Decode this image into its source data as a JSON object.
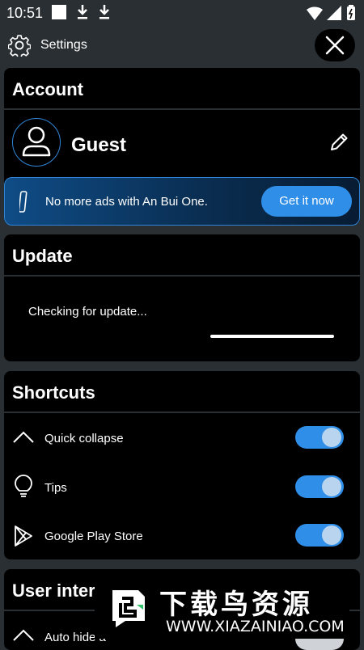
{
  "status_bar": {
    "time": "10:51"
  },
  "header": {
    "title": "Settings",
    "icons": {
      "settings": "gear-icon",
      "close": "close-icon"
    }
  },
  "account": {
    "title": "Account",
    "user_name": "Guest",
    "icons": {
      "avatar": "user-avatar-icon",
      "edit": "pencil-icon"
    }
  },
  "promo": {
    "text": "No more ads with An Bui One.",
    "button_label": "Get it now",
    "colors": {
      "accent": "#2f8ee8",
      "border": "#2f86d6"
    }
  },
  "update": {
    "title": "Update",
    "status": "Checking for update..."
  },
  "shortcuts": {
    "title": "Shortcuts",
    "items": [
      {
        "label": "Quick collapse",
        "icon": "chevron-up-icon",
        "enabled": true
      },
      {
        "label": "Tips",
        "icon": "lightbulb-icon",
        "enabled": true
      },
      {
        "label": "Google Play Store",
        "icon": "play-store-icon",
        "enabled": true
      }
    ]
  },
  "user_interface": {
    "title": "User interf",
    "items": [
      {
        "label": "Auto hide a",
        "icon": "chevron-up-icon",
        "enabled": false
      }
    ]
  },
  "watermark": {
    "title": "下载鸟资源",
    "url": "WWW.XIAZAINIAO.COM"
  }
}
